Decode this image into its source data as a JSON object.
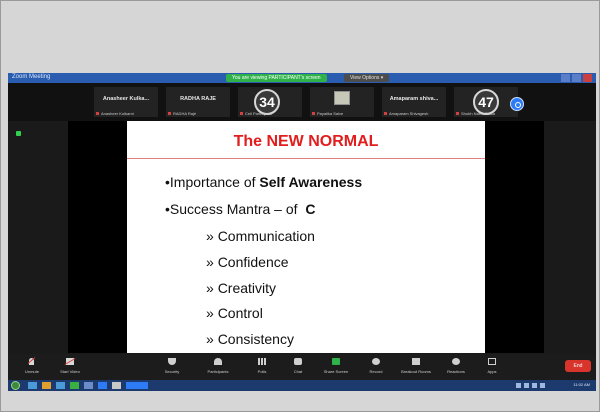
{
  "window": {
    "title": "Zoom Meeting",
    "share_banner": "You are viewing PARTICIPANT's screen",
    "view_options": "View Options ▾"
  },
  "participants": [
    {
      "name": "Anasheer Kulka...",
      "sub": "Anasheer Kulkarni"
    },
    {
      "name": "RADHA RAJE",
      "sub": "RADHA Rajé"
    },
    {
      "badge": "34",
      "sub": "Cell Participant"
    },
    {
      "sub": "Payalika Salve"
    },
    {
      "name": "Amaparam shiva...",
      "sub": "Amaparam Shivagesh"
    },
    {
      "badge": "47",
      "sub": "Shubh Nalini Phala"
    }
  ],
  "slide": {
    "title": "The NEW NORMAL",
    "bullet1_prefix": "Importance of ",
    "bullet1_bold": "Self Awareness",
    "bullet2_prefix": "Success Mantra – of  ",
    "bullet2_bold": "C",
    "items": [
      "Communication",
      "Confidence",
      "Creativity",
      "Control",
      "Consistency"
    ]
  },
  "controls": {
    "unmute": "Unmute",
    "start_video": "Start Video",
    "security": "Security",
    "participants": "Participants",
    "polls": "Polls",
    "chat": "Chat",
    "share_screen": "Share Screen",
    "record": "Record",
    "breakout_rooms": "Breakout Rooms",
    "reactions": "Reactions",
    "apps": "Apps",
    "end": "End"
  },
  "taskbar": {
    "clock": "11:02 AM"
  },
  "colors": {
    "slide_title": "#e21d1d",
    "share_green": "#2fb24a",
    "end_red": "#d9342b",
    "title_blue": "#2a5db0"
  }
}
